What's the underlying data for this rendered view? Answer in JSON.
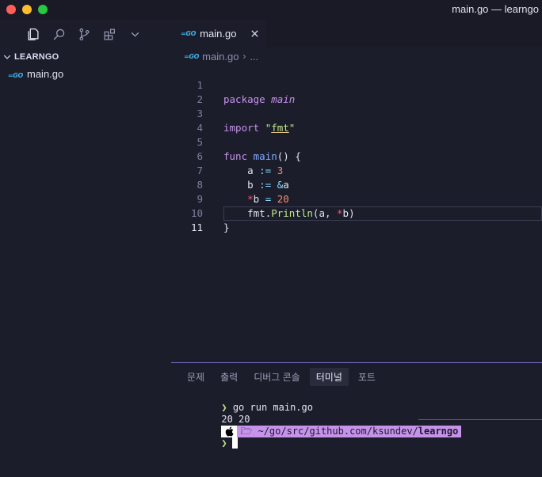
{
  "window": {
    "title": "main.go — learngo",
    "controls": [
      "close",
      "minimize",
      "maximize"
    ]
  },
  "activity": {
    "icons": [
      "files-icon",
      "search-icon",
      "source-control-icon",
      "extensions-icon",
      "chevron-down-icon"
    ]
  },
  "explorer": {
    "section_title": "LEARNGO",
    "files": [
      {
        "badge": "=GO",
        "name": "main.go"
      }
    ]
  },
  "editor": {
    "tab": {
      "badge": "=GO",
      "label": "main.go"
    },
    "breadcrumb": {
      "file": "main.go",
      "separator": "›",
      "trail": "..."
    },
    "lines": [
      {
        "n": "1"
      },
      {
        "n": "2"
      },
      {
        "n": "3"
      },
      {
        "n": "4"
      },
      {
        "n": "5"
      },
      {
        "n": "6"
      },
      {
        "n": "7"
      },
      {
        "n": "8"
      },
      {
        "n": "9"
      },
      {
        "n": "10"
      },
      {
        "n": "11"
      }
    ],
    "code": {
      "l1_kw": "package",
      "l1_name": "main",
      "l3_kw": "import",
      "l3_q1": "\"",
      "l3_pkg": "fmt",
      "l3_q2": "\"",
      "l5_kw": "func",
      "l5_fn": "main",
      "l5_rest": "() {",
      "l6_var": "a",
      "l6_op": ":=",
      "l6_num": "3",
      "l7_var": "b",
      "l7_op": ":=",
      "l7_amp": "&",
      "l7_ref": "a",
      "l8_star": "*",
      "l8_var": "b",
      "l8_op": "=",
      "l8_num": "20",
      "l9_pkg": "fmt",
      "l9_dot": ".",
      "l9_fn": "Println",
      "l9_open": "(",
      "l9_a": "a, ",
      "l9_star": "*",
      "l9_b": "b",
      "l9_close": ")",
      "l10": "}"
    }
  },
  "panel": {
    "tabs": [
      "문제",
      "출력",
      "디버그 콘솔",
      "터미널",
      "포트"
    ],
    "active_tab": "터미널",
    "terminal": {
      "prompt_symbol": "❯",
      "command": "go run main.go",
      "output": "20 20",
      "apple": "",
      "folder_glyph": "🗁",
      "path_prefix": "~/go/src/github.com/ksundev/",
      "path_dir": "learngo"
    }
  },
  "colors": {
    "background": "#1b1d2b",
    "keyword": "#c792ea",
    "function": "#82aaff",
    "string": "#c3e88d",
    "number": "#f78c6c",
    "operator": "#89ddff",
    "pointer": "#ff5370",
    "go_badge": "#3fb2e8",
    "panel_border": "#7b6fc9"
  }
}
